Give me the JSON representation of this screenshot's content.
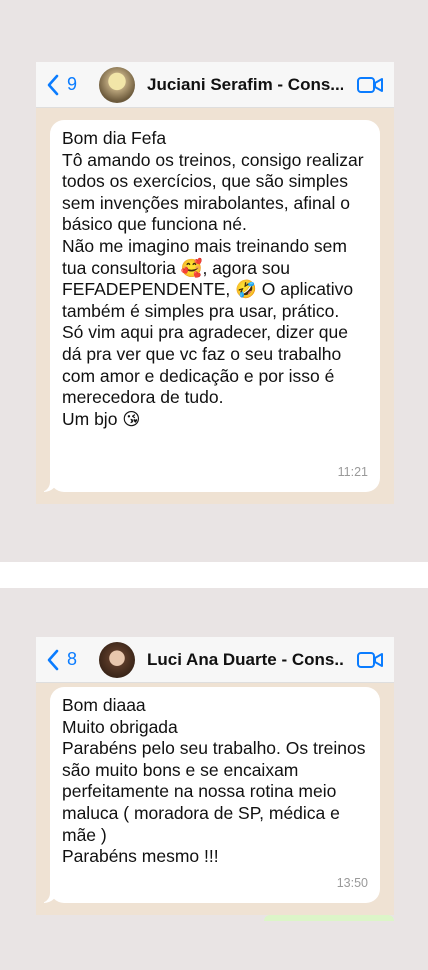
{
  "colors": {
    "accent": "#0a7cff",
    "bubble": "#ffffff",
    "chat_background": "#efe2d3",
    "page_background": "#e9e4e4"
  },
  "chat1": {
    "back_count": "9",
    "contact_name": "Juciani Serafim - Cons...",
    "message": "Bom dia Fefa\nTô amando os treinos, consigo realizar todos os exercícios, que são simples sem invenções mirabolantes, afinal o básico que funciona né.\nNão me imagino mais treinando sem tua consultoria 🥰, agora sou FEFADEPENDENTE, 🤣 O aplicativo também é simples pra usar, prático.\nSó vim aqui pra agradecer, dizer que dá pra ver que vc faz o seu trabalho com amor e dedicação e por isso é merecedora de tudo.\nUm bjo 😘",
    "time": "11:21"
  },
  "chat2": {
    "back_count": "8",
    "contact_name": "Luci Ana Duarte - Cons...",
    "message": "Bom diaaa\nMuito obrigada\nParabéns pelo seu trabalho. Os treinos são muito bons e se encaixam perfeitamente na nossa rotina meio maluca ( moradora de SP, médica e mãe )\nParabéns mesmo !!!",
    "time": "13:50"
  }
}
